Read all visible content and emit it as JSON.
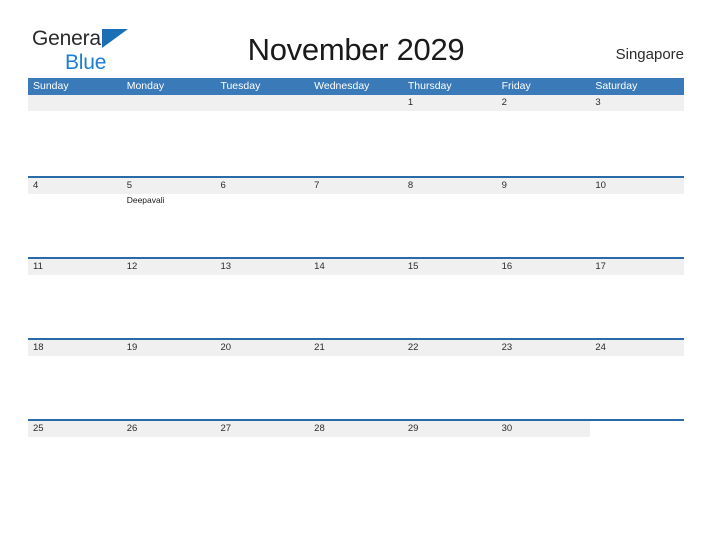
{
  "brand": {
    "name_part1": "General",
    "name_part2": "Blue",
    "flag_icon": "triangle-flag-icon",
    "color_primary": "#1a7fd4",
    "color_dark": "#2b2b2b"
  },
  "header": {
    "title": "November 2029",
    "location": "Singapore"
  },
  "theme": {
    "header_blue": "#3a7ab8",
    "rule_blue": "#2a6aa8",
    "strip_gray": "#f0f0f0"
  },
  "calendar": {
    "month": "November",
    "year": "2029",
    "day_names": [
      "Sunday",
      "Monday",
      "Tuesday",
      "Wednesday",
      "Thursday",
      "Friday",
      "Saturday"
    ],
    "weeks": [
      [
        {
          "date": "",
          "events": []
        },
        {
          "date": "",
          "events": []
        },
        {
          "date": "",
          "events": []
        },
        {
          "date": "",
          "events": []
        },
        {
          "date": "1",
          "events": []
        },
        {
          "date": "2",
          "events": []
        },
        {
          "date": "3",
          "events": []
        }
      ],
      [
        {
          "date": "4",
          "events": []
        },
        {
          "date": "5",
          "events": [
            "Deepavali"
          ]
        },
        {
          "date": "6",
          "events": []
        },
        {
          "date": "7",
          "events": []
        },
        {
          "date": "8",
          "events": []
        },
        {
          "date": "9",
          "events": []
        },
        {
          "date": "10",
          "events": []
        }
      ],
      [
        {
          "date": "11",
          "events": []
        },
        {
          "date": "12",
          "events": []
        },
        {
          "date": "13",
          "events": []
        },
        {
          "date": "14",
          "events": []
        },
        {
          "date": "15",
          "events": []
        },
        {
          "date": "16",
          "events": []
        },
        {
          "date": "17",
          "events": []
        }
      ],
      [
        {
          "date": "18",
          "events": []
        },
        {
          "date": "19",
          "events": []
        },
        {
          "date": "20",
          "events": []
        },
        {
          "date": "21",
          "events": []
        },
        {
          "date": "22",
          "events": []
        },
        {
          "date": "23",
          "events": []
        },
        {
          "date": "24",
          "events": []
        }
      ],
      [
        {
          "date": "25",
          "events": []
        },
        {
          "date": "26",
          "events": []
        },
        {
          "date": "27",
          "events": []
        },
        {
          "date": "28",
          "events": []
        },
        {
          "date": "29",
          "events": []
        },
        {
          "date": "30",
          "events": []
        },
        {
          "date": "",
          "events": []
        }
      ]
    ]
  }
}
